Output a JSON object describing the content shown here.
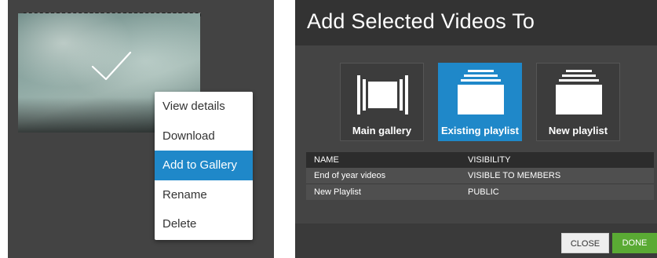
{
  "context_menu": {
    "items": [
      {
        "label": "View details",
        "active": false
      },
      {
        "label": "Download",
        "active": false
      },
      {
        "label": "Add to Gallery",
        "active": true
      },
      {
        "label": "Rename",
        "active": false
      },
      {
        "label": "Delete",
        "active": false
      }
    ]
  },
  "dialog": {
    "title": "Add Selected Videos To",
    "options": [
      {
        "label": "Main gallery",
        "icon": "main-gallery-icon",
        "selected": false
      },
      {
        "label": "Existing playlist",
        "icon": "playlist-stack-icon",
        "selected": true
      },
      {
        "label": "New playlist",
        "icon": "playlist-stack-icon",
        "selected": false
      }
    ],
    "table": {
      "columns": [
        "NAME",
        "VISIBILITY"
      ],
      "rows": [
        [
          "End of year videos",
          "VISIBLE TO MEMBERS"
        ],
        [
          "New Playlist",
          "PUBLIC"
        ]
      ]
    },
    "buttons": {
      "close": "CLOSE",
      "done": "DONE"
    }
  },
  "colors": {
    "accent": "#1f88c9",
    "done_button": "#5aaa34",
    "panel_background": "#434343",
    "dialog_header": "#333333"
  }
}
